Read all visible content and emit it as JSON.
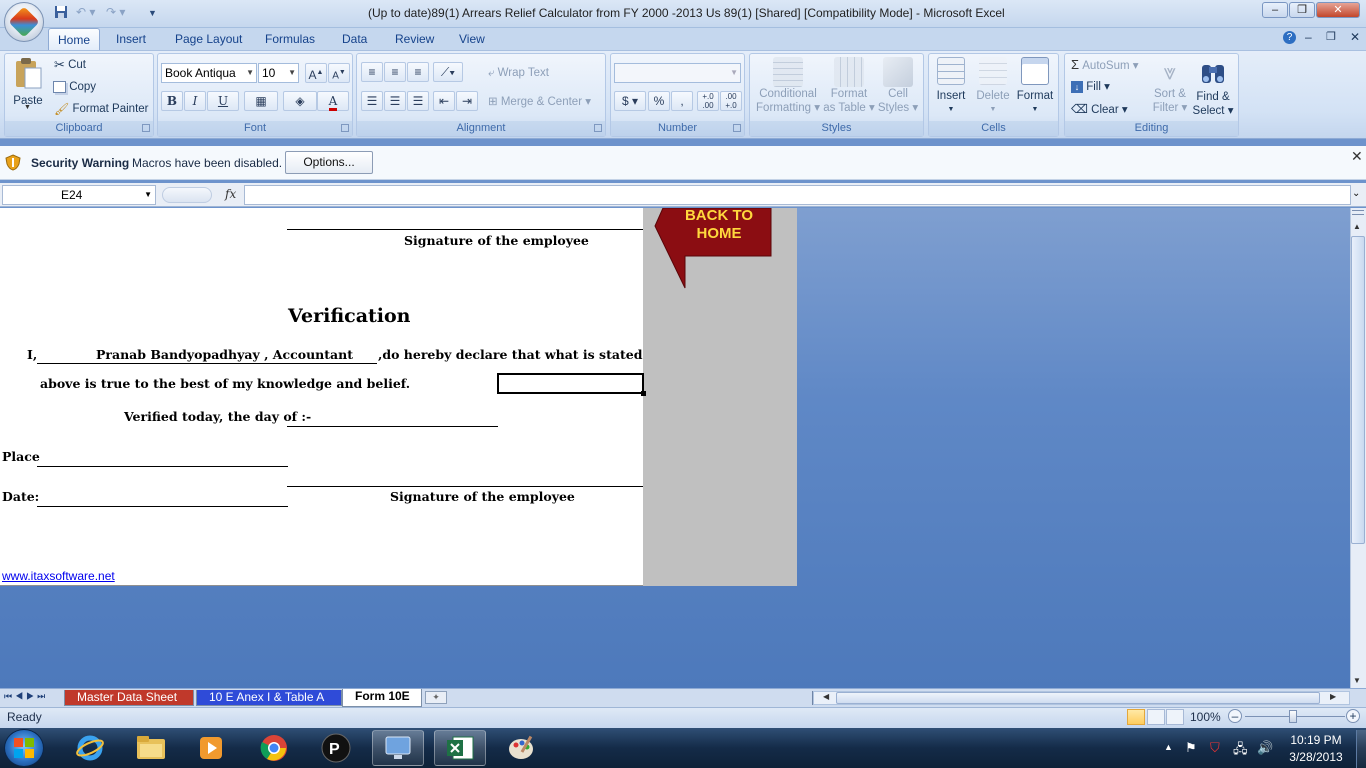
{
  "titlebar": {
    "title": "(Up to date)89(1) Arrears Relief Calculator  from FY 2000 -2013 Us 89(1)  [Shared]  [Compatibility Mode] - Microsoft Excel"
  },
  "ribbon_tabs": [
    "Home",
    "Insert",
    "Page Layout",
    "Formulas",
    "Data",
    "Review",
    "View"
  ],
  "ribbon": {
    "clipboard": {
      "paste": "Paste",
      "cut": "Cut",
      "copy": "Copy",
      "format_painter": "Format Painter",
      "caption": "Clipboard"
    },
    "font": {
      "name": "Book Antiqua",
      "size": "10",
      "bold": "B",
      "italic": "I",
      "underline": "U",
      "grow": "A",
      "shrink": "A",
      "font_color": "A",
      "caption": "Font"
    },
    "alignment": {
      "wrap_text": "Wrap Text",
      "merge_center": "Merge & Center",
      "caption": "Alignment"
    },
    "number": {
      "currency": "$",
      "percent": "%",
      "comma": ",",
      "inc_decimal": "+.0 .00",
      "dec_decimal": ".00 +.0",
      "caption": "Number"
    },
    "styles": {
      "cond_format_1": "Conditional",
      "cond_format_2": "Formatting",
      "format_table_1": "Format",
      "format_table_2": "as Table",
      "cell_styles_1": "Cell",
      "cell_styles_2": "Styles",
      "caption": "Styles"
    },
    "cells": {
      "insert": "Insert",
      "delete": "Delete",
      "format": "Format",
      "caption": "Cells"
    },
    "editing": {
      "autosum": "AutoSum",
      "fill": "Fill",
      "clear": "Clear",
      "sort_1": "Sort &",
      "sort_2": "Filter",
      "find_1": "Find &",
      "find_2": "Select",
      "caption": "Editing"
    }
  },
  "security": {
    "title": "Security Warning",
    "message": "Macros have been disabled.",
    "options": "Options..."
  },
  "formula_bar": {
    "name_box": "E24",
    "fx": "fx",
    "formula": ""
  },
  "sheet": {
    "sig_top": "Signature of the employee",
    "verification_title": "Verification",
    "i_label": "I,",
    "declarant": "Pranab Bandyopadhyay , Accountant",
    "declare_text": ",do hereby declare that what is stated",
    "belief_text": "above is true to the best of my knowledge and belief.",
    "verified_text": "Verified today, the day of :-",
    "place_label": "Place",
    "date_label": "Date:",
    "sig_bottom": "Signature of the employee",
    "link": "www.itaxsoftware.net",
    "back_home_1": "BACK TO",
    "back_home_2": "HOME"
  },
  "sheet_tabs": [
    {
      "label": "Master Data Sheet",
      "color": "#c0392b"
    },
    {
      "label": "10 E Anex I & Table A",
      "color": "#2f4bd8"
    },
    {
      "label": "Form 10E",
      "color": "#ffffff"
    }
  ],
  "status": {
    "text": "Ready",
    "zoom": "100%"
  },
  "taskbar": {
    "time": "10:19 PM",
    "date": "3/28/2013"
  }
}
